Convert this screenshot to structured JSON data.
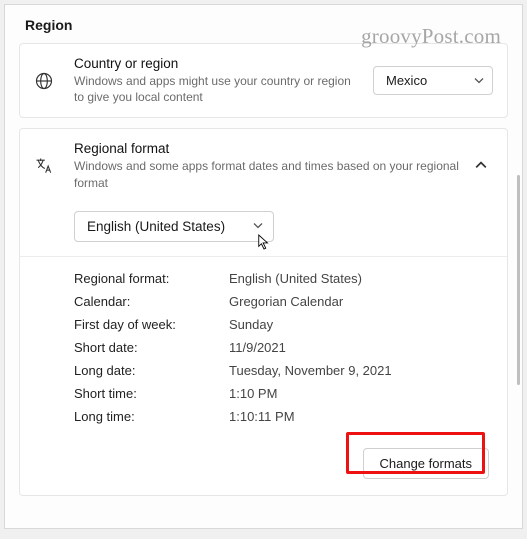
{
  "watermark": "groovyPost.com",
  "page_title": "Region",
  "country_card": {
    "heading": "Country or region",
    "sub": "Windows and apps might use your country or region to give you local content",
    "selected": "Mexico"
  },
  "regional_card": {
    "heading": "Regional format",
    "sub": "Windows and some apps format dates and times based on your regional format",
    "selected_format": "English (United States)",
    "rows": [
      {
        "k": "Regional format:",
        "v": "English (United States)"
      },
      {
        "k": "Calendar:",
        "v": "Gregorian Calendar"
      },
      {
        "k": "First day of week:",
        "v": "Sunday"
      },
      {
        "k": "Short date:",
        "v": "11/9/2021"
      },
      {
        "k": "Long date:",
        "v": "Tuesday, November 9, 2021"
      },
      {
        "k": "Short time:",
        "v": "1:10 PM"
      },
      {
        "k": "Long time:",
        "v": "1:10:11 PM"
      }
    ],
    "button": "Change formats"
  }
}
